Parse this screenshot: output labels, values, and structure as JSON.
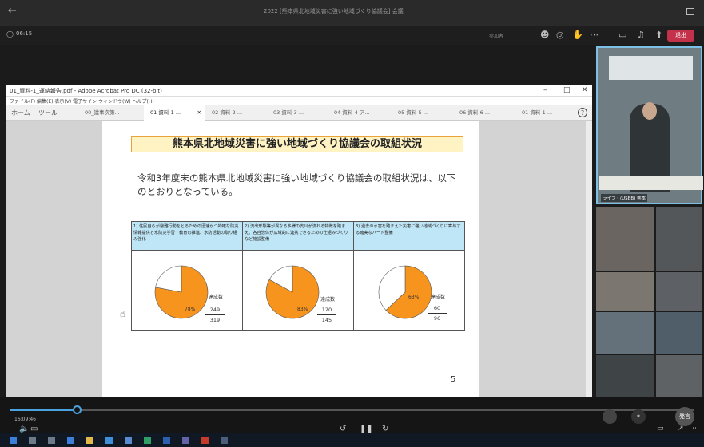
{
  "window": {
    "title": "2022 [熊本県北地域災害に強い地域づくり協議会] 会議"
  },
  "meeting": {
    "timer": "06:15",
    "controls": [
      "参加者",
      "チャット",
      "リアクション",
      "その他",
      "カメラ",
      "マイク",
      "共有"
    ],
    "leave_label": "退出"
  },
  "acrobat": {
    "title": "01_資料-1_運絡報告.pdf - Adobe Acrobat Pro DC (32-bit)",
    "menu": "ファイル(F)  編集(E)  表示(V)  電子サイン  ウィンドウ(W)  ヘルプ(H)",
    "home_label": "ホーム",
    "tools_label": "ツール",
    "tabs": [
      "00_議事次第...",
      "01 資料-1 ...",
      "02 資料-2 ...",
      "03 資料-3 ...",
      "04 資料-4 ア...",
      "05 資料-5 ...",
      "06 資料-6 ...",
      "01 資料-1 ..."
    ],
    "help_icon": "?"
  },
  "slide": {
    "title": "熊本県北地域災害に強い地域づくり協議会の取組状況",
    "body": "令和3年度末の熊本県北地域災害に強い地域づくり協議会の取組状況は、以下のとおりとなっている。",
    "page_number": "5",
    "columns": [
      {
        "header": "1) 住民自らが避難行動をとるための迅速かつ的確な防災情報提供と水防災学習・教育の推進、水防活動の取り組み強化",
        "percent_label": "78%",
        "done_label": "達成数",
        "numerator": "249",
        "denominator": "319",
        "fraction": 0.78
      },
      {
        "header": "2) 流出形態等が異なる多様の支川が流れる特徴を踏まえ、各自治体が広域的に連携できるための仕組みづくりなど施設整備",
        "percent_label": "83%",
        "done_label": "達成数",
        "numerator": "120",
        "denominator": "145",
        "fraction": 0.83
      },
      {
        "header": "3) 過去の水害を踏まえた災害に強い地域づくりに寄与する確実なハード整備",
        "percent_label": "63%",
        "done_label": "達成数",
        "numerator": "60",
        "denominator": "96",
        "fraction": 0.63
      }
    ]
  },
  "colors": {
    "accent": "#4aa3e0",
    "pie": "#f7941e",
    "leave": "#c4314b",
    "header_fill": "#bfe6f6",
    "title_fill": "#fff3c4"
  },
  "video": {
    "main_name": "ライブ・(USBB) 熊本",
    "active_speaker_label": "発言"
  },
  "player": {
    "time": "16:09:46"
  }
}
